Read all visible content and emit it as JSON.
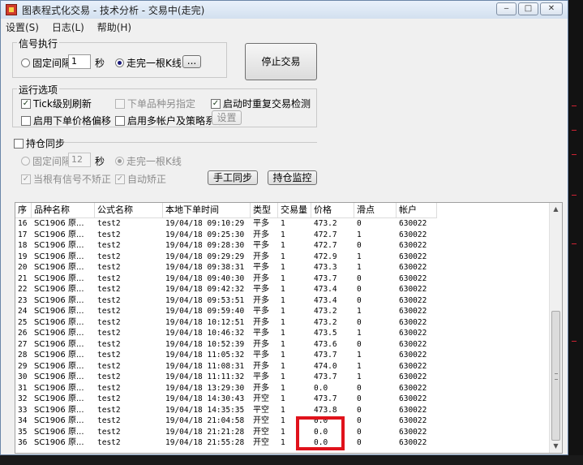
{
  "window": {
    "title": "图表程式化交易 - 技术分析 - 交易中(走完)"
  },
  "menu": [
    "设置(S)",
    "日志(L)",
    "帮助(H)"
  ],
  "signal": {
    "label": "信号执行",
    "fixed_interval": "固定间隔",
    "interval_value": "1",
    "unit": "秒",
    "after_bar": "走完一根K线",
    "more_btn": "...",
    "stop_btn": "停止交易"
  },
  "run": {
    "label": "运行选项",
    "tick_refresh": "Tick级别刷新",
    "order_other": "下单品种另指定",
    "restart_check": "启动时重复交易检测",
    "price_offset": "启用下单价格偏移",
    "multi_account": "启用多帐户及策略系数",
    "settings_btn": "设置"
  },
  "sync": {
    "label": "持仓同步",
    "fixed_interval": "固定间隔",
    "interval_value": "12",
    "unit": "秒",
    "after_bar": "走完一根K线",
    "no_fix": "当根有信号不矫正",
    "auto_fix": "自动矫正",
    "manual_btn": "手工同步",
    "monitor_btn": "持仓监控"
  },
  "table": {
    "columns": [
      "序",
      "品种名称",
      "公式名称",
      "本地下单时间",
      "类型",
      "交易量",
      "价格",
      "滑点",
      "帐户"
    ],
    "rows": [
      [
        "16",
        "SC1906 原...",
        "test2",
        "19/04/18 09:10:29",
        "平多",
        "1",
        "473.2",
        "0",
        "630022"
      ],
      [
        "17",
        "SC1906 原...",
        "test2",
        "19/04/18 09:25:30",
        "开多",
        "1",
        "472.7",
        "1",
        "630022"
      ],
      [
        "18",
        "SC1906 原...",
        "test2",
        "19/04/18 09:28:30",
        "平多",
        "1",
        "472.7",
        "0",
        "630022"
      ],
      [
        "19",
        "SC1906 原...",
        "test2",
        "19/04/18 09:29:29",
        "开多",
        "1",
        "472.9",
        "1",
        "630022"
      ],
      [
        "20",
        "SC1906 原...",
        "test2",
        "19/04/18 09:38:31",
        "平多",
        "1",
        "473.3",
        "1",
        "630022"
      ],
      [
        "21",
        "SC1906 原...",
        "test2",
        "19/04/18 09:40:30",
        "开多",
        "1",
        "473.7",
        "0",
        "630022"
      ],
      [
        "22",
        "SC1906 原...",
        "test2",
        "19/04/18 09:42:32",
        "平多",
        "1",
        "473.4",
        "0",
        "630022"
      ],
      [
        "23",
        "SC1906 原...",
        "test2",
        "19/04/18 09:53:51",
        "开多",
        "1",
        "473.4",
        "0",
        "630022"
      ],
      [
        "24",
        "SC1906 原...",
        "test2",
        "19/04/18 09:59:40",
        "平多",
        "1",
        "473.2",
        "1",
        "630022"
      ],
      [
        "25",
        "SC1906 原...",
        "test2",
        "19/04/18 10:12:51",
        "开多",
        "1",
        "473.2",
        "0",
        "630022"
      ],
      [
        "26",
        "SC1906 原...",
        "test2",
        "19/04/18 10:46:32",
        "平多",
        "1",
        "473.5",
        "1",
        "630022"
      ],
      [
        "27",
        "SC1906 原...",
        "test2",
        "19/04/18 10:52:39",
        "开多",
        "1",
        "473.6",
        "0",
        "630022"
      ],
      [
        "28",
        "SC1906 原...",
        "test2",
        "19/04/18 11:05:32",
        "平多",
        "1",
        "473.7",
        "1",
        "630022"
      ],
      [
        "29",
        "SC1906 原...",
        "test2",
        "19/04/18 11:08:31",
        "开多",
        "1",
        "474.0",
        "1",
        "630022"
      ],
      [
        "30",
        "SC1906 原...",
        "test2",
        "19/04/18 11:11:32",
        "平多",
        "1",
        "473.7",
        "1",
        "630022"
      ],
      [
        "31",
        "SC1906 原...",
        "test2",
        "19/04/18 13:29:30",
        "开多",
        "1",
        "0.0",
        "0",
        "630022"
      ],
      [
        "32",
        "SC1906 原...",
        "test2",
        "19/04/18 14:30:43",
        "开空",
        "1",
        "473.7",
        "0",
        "630022"
      ],
      [
        "33",
        "SC1906 原...",
        "test2",
        "19/04/18 14:35:35",
        "平空",
        "1",
        "473.8",
        "0",
        "630022"
      ],
      [
        "34",
        "SC1906 原...",
        "test2",
        "19/04/18 21:04:58",
        "开空",
        "1",
        "0.0",
        "0",
        "630022"
      ],
      [
        "35",
        "SC1906 原...",
        "test2",
        "19/04/18 21:21:28",
        "开空",
        "1",
        "0.0",
        "0",
        "630022"
      ],
      [
        "36",
        "SC1906 原...",
        "test2",
        "19/04/18 21:55:28",
        "开空",
        "1",
        "0.0",
        "0",
        "630022"
      ]
    ]
  }
}
